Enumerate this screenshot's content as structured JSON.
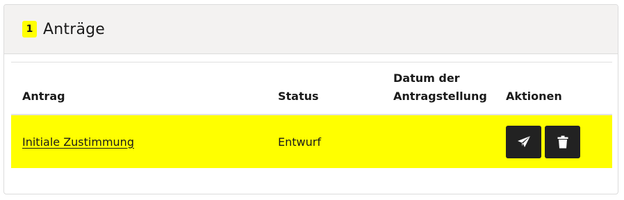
{
  "panel": {
    "count": "1",
    "title": "Anträge"
  },
  "table": {
    "headers": {
      "antrag": "Antrag",
      "status": "Status",
      "datum": "Datum der Antragstellung",
      "aktionen": "Aktionen"
    },
    "rows": [
      {
        "antrag": "Initiale Zustimmung",
        "status": "Entwurf",
        "datum": "",
        "actions": [
          "send-icon",
          "trash-icon"
        ]
      }
    ]
  },
  "colors": {
    "highlight": "#ffff00",
    "header_bg": "#f3f2f1",
    "button_bg": "#222222"
  }
}
